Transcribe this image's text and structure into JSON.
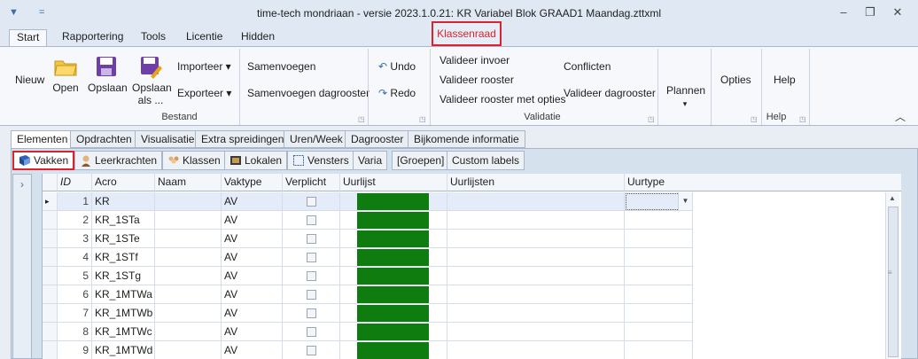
{
  "window": {
    "title": "time-tech mondriaan - versie 2023.1.0.21: KR Variabel Blok GRAAD1 Maandag.zttxml",
    "minimize": "–",
    "restore": "❐",
    "close": "✕",
    "qa_icon": "▼",
    "qa_small": "="
  },
  "ribbon_tabs": [
    "Start",
    "Rapportering",
    "Tools",
    "Licentie",
    "Hidden"
  ],
  "context_tab": "Klassenraad",
  "ribbon": {
    "nieuw": "Nieuw",
    "open": "Open",
    "opslaan": "Opslaan",
    "opslaan_als": "Opslaan als ...",
    "importeer": "Importeer ▾",
    "exporteer": "Exporteer ▾",
    "samenvoegen": "Samenvoegen",
    "samenvoegen_dag": "Samenvoegen dagrooster",
    "bestand": "Bestand",
    "undo": "Undo",
    "redo": "Redo",
    "valideer_invoer": "Valideer invoer",
    "valideer_rooster": "Valideer rooster",
    "valideer_rooster_opties": "Valideer rooster met opties",
    "conflicten": "Conflicten",
    "valideer_dagrooster": "Valideer dagrooster",
    "validatie": "Validatie",
    "plannen": "Plannen",
    "plannen_arrow": "▾",
    "opties": "Opties",
    "help": "Help",
    "help_group": "Help",
    "collapse": "︿"
  },
  "element_tabs": [
    "Elementen",
    "Opdrachten",
    "Visualisatie",
    "Extra spreidingen",
    "Uren/Week",
    "Dagrooster",
    "Bijkomende informatie"
  ],
  "sub_tabs": [
    "Vakken",
    "Leerkrachten",
    "Klassen",
    "Lokalen",
    "Vensters",
    "Varia",
    "[Groepen]",
    "Custom labels"
  ],
  "left_strip": "›",
  "grid": {
    "columns": [
      "ID",
      "Acro",
      "Naam",
      "Vaktype",
      "Verplicht",
      "Uurlijst",
      "Uurlijsten",
      "Uurtype"
    ],
    "rows": [
      {
        "id": "1",
        "acro": "KR",
        "naam": "",
        "vaktype": "AV"
      },
      {
        "id": "2",
        "acro": "KR_1STa",
        "naam": "",
        "vaktype": "AV"
      },
      {
        "id": "3",
        "acro": "KR_1STe",
        "naam": "",
        "vaktype": "AV"
      },
      {
        "id": "4",
        "acro": "KR_1STf",
        "naam": "",
        "vaktype": "AV"
      },
      {
        "id": "5",
        "acro": "KR_1STg",
        "naam": "",
        "vaktype": "AV"
      },
      {
        "id": "6",
        "acro": "KR_1MTWa",
        "naam": "",
        "vaktype": "AV"
      },
      {
        "id": "7",
        "acro": "KR_1MTWb",
        "naam": "",
        "vaktype": "AV"
      },
      {
        "id": "8",
        "acro": "KR_1MTWc",
        "naam": "",
        "vaktype": "AV"
      },
      {
        "id": "9",
        "acro": "KR_1MTWd",
        "naam": "",
        "vaktype": "AV"
      }
    ],
    "current_row_marker": "▸",
    "dropdown_arrow": "▼",
    "scroll_up": "▲",
    "scroll_grip": "≡"
  },
  "colors": {
    "uurlijst_fill": "#0f7c0f",
    "highlight": "#d9232e"
  }
}
